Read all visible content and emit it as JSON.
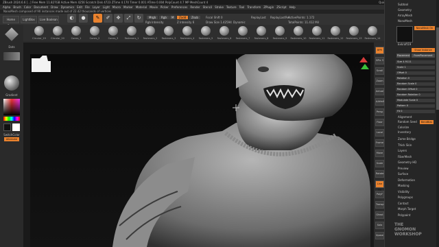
{
  "titlebar": {
    "text": "ZBrush 2024.6.6  [...]  Free Mem 11.827GB  Active Mem 4256  Scratch Disk 4723  ZTime 4.170  Timer 0.001  ATime 0.004  PolyCount 4.7 MP  MeshCount 4",
    "quicksave": "QuickSave",
    "menus": "Menus",
    "default_script": "DefaultZScript"
  },
  "menubar": [
    "Alpha",
    "Brush",
    "Color",
    "Document",
    "Draw",
    "Dynamics",
    "Edit",
    "File",
    "Layer",
    "Light",
    "Macro",
    "Marker",
    "Material",
    "Movie",
    "Picker",
    "Preferences",
    "Render",
    "Stencil",
    "Stroke",
    "Texture",
    "Tool",
    "Transform",
    "ZPlugin",
    "ZScript",
    "Help"
  ],
  "notebar": {
    "text": "NanoMesh composed of 90 instances made out of 22.42 thousands of vertices"
  },
  "top_controls": {
    "tabs": [
      "Home Page",
      "LightBox",
      "Live Boolean"
    ],
    "tools": [
      {
        "label": "Edit",
        "icon": "edit-icon",
        "on": true
      },
      {
        "label": "Draw",
        "icon": "draw-icon",
        "on": false
      },
      {
        "label": "Move",
        "icon": "move-icon",
        "on": false
      },
      {
        "label": "Scale",
        "icon": "scale-icon",
        "on": false
      },
      {
        "label": "Rotate",
        "icon": "rotate-icon",
        "on": false
      }
    ],
    "mrgb": "Mrgb",
    "rgb": "Rgb",
    "m": "M",
    "zadd": "Zadd",
    "zsub": "Zsub",
    "zcut": "Zcut",
    "rgb_intensity": "Rgb Intensity",
    "z_intensity": "Z Intensity 6",
    "focal_shift": "Focal Shift 0",
    "draw_size": "Draw Size 1.42594",
    "dynamic": "Dynamic",
    "replay_last": "ReplayLast",
    "replay_last_rel": "ReplayLastRel",
    "active_points": "ActivePoints: 1.172",
    "total_points": "TotalPoints: 11.412 Mil"
  },
  "brush_shelf": [
    "Circular_19",
    "Circular_20",
    "Cones_1",
    "Cones_2",
    "Cones_3",
    "Fasteners_1",
    "Fasteners_2",
    "Fasteners_3",
    "Fasteners_4",
    "Fasteners_5",
    "Fasteners_6",
    "Fasteners_7",
    "Fasteners_8",
    "Fasteners_9",
    "Fasteners_10",
    "Fasteners_11",
    "Fasteners_12",
    "Fasteners_13",
    "Fasteners_14"
  ],
  "left_panel": {
    "material_label": "Gradient",
    "switch_color": "SwitchColor",
    "alternate": "Alternate",
    "dots": "Dots"
  },
  "right_strip": [
    "BPR",
    "SPix 3",
    "Scroll",
    "Zoom",
    "Actual",
    "AAHalf",
    "Persp",
    "Floor",
    "Local",
    "Frame",
    "Move",
    "Scale",
    "Rotate",
    "Line Fill",
    "PolyF",
    "Transp",
    "Ghost",
    "Solo",
    "Xpose"
  ],
  "right_panel": {
    "header": [
      "Subtool",
      "Geometry",
      "ArrayMesh",
      "NanoMesh"
    ],
    "brush_name": "Exkraft19",
    "nanomesh_on": "NanoMesh On",
    "show_instance": "Show Instance",
    "placement": "Placement",
    "from_placement": "FromPlacement",
    "sliders": [
      {
        "label": "Size 4.9111",
        "level": 0.45
      },
      {
        "label": "Scale 1",
        "level": 0.5
      },
      {
        "label": "Offset 0",
        "level": 0.0
      },
      {
        "label": "Rotation 0",
        "level": 0.0
      },
      {
        "label": "Random Scale 0",
        "level": 0.0
      },
      {
        "label": "Random Offset 0",
        "level": 0.0
      },
      {
        "label": "Random Rotation 0",
        "level": 0.0
      },
      {
        "label": "Modulate Scale 0",
        "level": 0.0
      },
      {
        "label": "Pattern 0",
        "level": 0.0
      },
      {
        "label": "Fit 0",
        "level": 0.0
      }
    ],
    "alignment": "Alignment",
    "random_seed": "Random Seed",
    "bend_bias": "BendBias",
    "colorize": "Colorize",
    "inventory": "Inventory",
    "sections": [
      "Zome Bridge",
      "Thick Skin",
      "Layers",
      "FiberMesh",
      "Geometry HD",
      "Preview",
      "Surface",
      "Deformation",
      "Masking",
      "Visibility",
      "Polygroups",
      "Contact",
      "Morph Target",
      "Polypaint"
    ],
    "watermark": [
      "THE",
      "GNOMON",
      "WORKSHOP"
    ]
  },
  "colors": {
    "accent": "#e9822e",
    "panel": "#2b2b2b",
    "canvas": "#0f0f0f"
  }
}
